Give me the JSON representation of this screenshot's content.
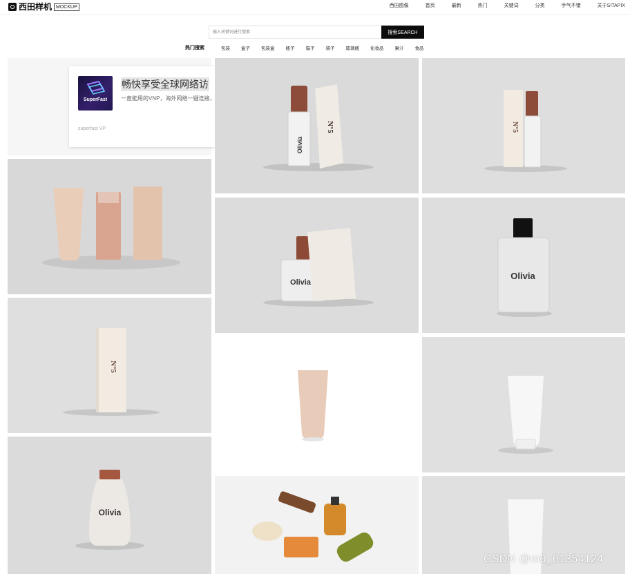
{
  "header": {
    "logo_text": "西田样机",
    "logo_badge": "MOCKUP",
    "nav": [
      "西田图像",
      "首页",
      "最新",
      "热门",
      "关键词",
      "分类",
      "手气不错",
      "关于SITAPIX"
    ]
  },
  "search": {
    "placeholder": "输入关键词进行搜索",
    "button_label": "搜索SEARCH"
  },
  "hot": {
    "label": "热门搜索",
    "tags": [
      "包装",
      "盒子",
      "包装盒",
      "瓶子",
      "箱子",
      "袋子",
      "玻璃瓶",
      "化妆品",
      "果汁",
      "食品"
    ]
  },
  "ad": {
    "logo_text": "SuperFast",
    "title": "畅快享受全球网络访",
    "desc": "一直能用的VNP，海外网络一键连接，",
    "foot": "superfast VP"
  },
  "products": {
    "olivia": "Olivia",
    "no5": "N°5"
  },
  "watermark": "CSDN @m0_61354124",
  "colors": {
    "accent_dark": "#0c0c0c",
    "tile_gray": "#dcdcdc",
    "cap_copper": "#9a5a42"
  }
}
